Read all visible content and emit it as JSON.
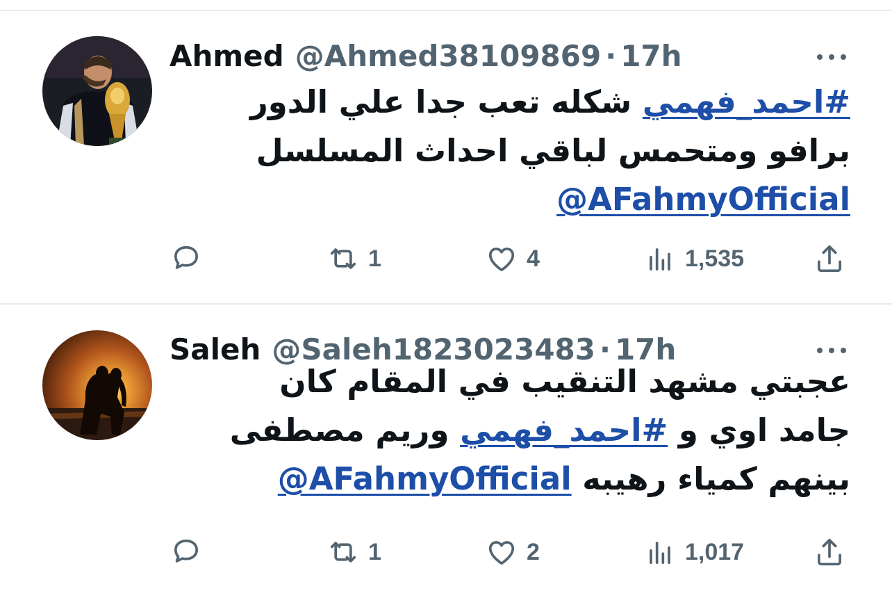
{
  "tweets": [
    {
      "name": "Ahmed",
      "handle": "@Ahmed38109869",
      "separator": "·",
      "time": "17h",
      "body_lines": [
        {
          "hashtag": "#احمد_فهمي",
          "text": " شكله تعب جدا علي الدور"
        },
        {
          "text": "برافو ومتحمس لباقي احداث المسلسل"
        },
        {
          "mention": "@AFahmyOfficial"
        }
      ],
      "replies": "",
      "retweets": "1",
      "likes": "4",
      "views": "1,535"
    },
    {
      "name": "Saleh",
      "handle": "@Saleh1823023483",
      "separator": "·",
      "time": "17h",
      "body_lines": [
        {
          "text": "عجبتي مشهد التنقيب في المقام كان"
        },
        {
          "pre": "جامد اوي و ",
          "hashtag": "#احمد_فهمي",
          "post": " وريم مصطفى"
        },
        {
          "pre": "بينهم كمياء رهيبه ",
          "mention": "@AFahmyOfficial"
        }
      ],
      "replies": "",
      "retweets": "1",
      "likes": "2",
      "views": "1,017"
    }
  ],
  "icons": {
    "reply": "speech-bubble-icon",
    "retweet": "retweet-arrows-icon",
    "like": "heart-outline-icon",
    "views": "bar-chart-icon",
    "share": "share-upload-icon",
    "more": "three-dots-icon"
  },
  "colors": {
    "link": "#1d4ea8",
    "secondary_text": "#536471",
    "primary_text": "#0f1419",
    "divider": "#e7e9ea"
  }
}
